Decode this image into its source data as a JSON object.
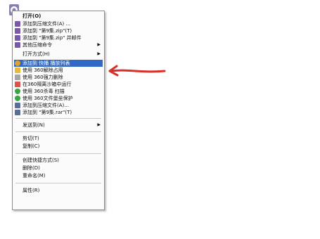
{
  "menu": {
    "items": [
      {
        "label": "打开(O)",
        "icon": "none",
        "bold": true
      },
      {
        "label": "添加到压缩文件(A) ...",
        "icon": "winrar-icon",
        "color": "#7a5aa8"
      },
      {
        "label": "添加到 \"第9集.zip\"(T)",
        "icon": "winrar-icon",
        "color": "#7a5aa8"
      },
      {
        "label": "添加到 \"第9集.zip\" 并邮件",
        "icon": "winrar-icon",
        "color": "#7a5aa8"
      },
      {
        "label": "其他压缩命令",
        "icon": "winrar-icon",
        "color": "#7a5aa8",
        "submenu": true
      },
      {
        "label": "打开方式(H)",
        "icon": "none",
        "submenu": true
      },
      {
        "label": "添加到 快播 播放列表",
        "icon": "qvod-icon",
        "color": "#e0a12c",
        "highlighted": true
      },
      {
        "label": "使用 360解除占用",
        "icon": "unlock-icon",
        "color": "#e8b93a"
      },
      {
        "label": "使用 360强力删除",
        "icon": "delete-icon",
        "color": "#a6a6a6"
      },
      {
        "label": "在360隔离沙箱中运行",
        "icon": "sandbox-icon",
        "color": "#d9534f"
      },
      {
        "label": "使用 360杀毒 扫描",
        "icon": "shield-icon",
        "color": "#3aa545"
      },
      {
        "label": "使用 360文件堡垒保护",
        "icon": "shield-icon",
        "color": "#3aa545"
      },
      {
        "label": "添加到压缩文件(A)...",
        "icon": "archive-icon",
        "color": "#5b6e9b"
      },
      {
        "label": "添加到 \"第9集.rar\"(T)",
        "icon": "archive-icon",
        "color": "#5b6e9b"
      },
      {
        "label": "发送到(N)",
        "icon": "none",
        "submenu": true
      },
      {
        "label": "剪切(T)",
        "icon": "none"
      },
      {
        "label": "复制(C)",
        "icon": "none"
      },
      {
        "label": "创建快捷方式(S)",
        "icon": "none"
      },
      {
        "label": "删除(D)",
        "icon": "none"
      },
      {
        "label": "重命名(M)",
        "icon": "none"
      },
      {
        "label": "属性(R)",
        "icon": "none"
      }
    ],
    "submenu_arrow": "▶",
    "highlight_color": "#3169c6"
  },
  "annotation": {
    "arrow_color": "#d9302a"
  }
}
